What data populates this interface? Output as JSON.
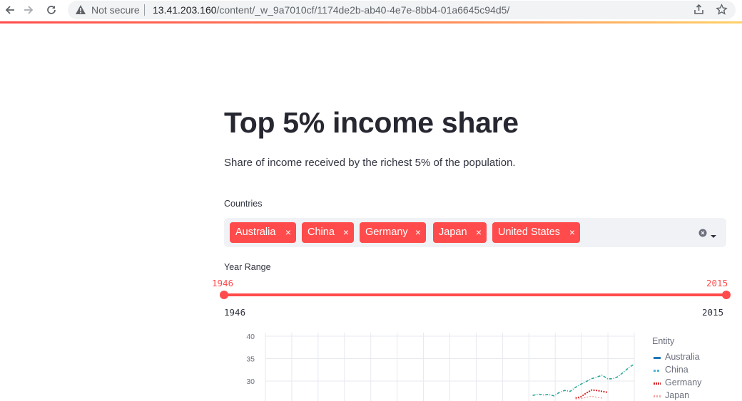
{
  "browser": {
    "security_label": "Not secure",
    "url_host": "13.41.203.160",
    "url_path": "/content/_w_9a7010cf/1174de2b-ab40-4e7e-8bb4-01a6645c94d5/"
  },
  "page": {
    "title": "Top 5% income share",
    "subtitle": "Share of income received by the richest 5% of the population.",
    "countries_label": "Countries",
    "selected_countries": [
      {
        "label": "Australia",
        "remove": "×"
      },
      {
        "label": "China",
        "remove": "×"
      },
      {
        "label": "Germany",
        "remove": "×"
      },
      {
        "label": "Japan",
        "remove": "×"
      },
      {
        "label": "United States",
        "remove": "×"
      }
    ],
    "year_range_label": "Year Range",
    "year_range": {
      "selected_min": "1946",
      "selected_max": "2015",
      "min": "1946",
      "max": "2015"
    }
  },
  "colors": {
    "accent": "#ff4b4b",
    "australia": "#1f77b4",
    "china": "#4fb5d9",
    "germany": "#d62728",
    "japan": "#f4a6a6",
    "usa_visible_line": "#2ca89a"
  },
  "chart_data": {
    "type": "line",
    "y_ticks": [
      "40",
      "35",
      "30"
    ],
    "legend_title": "Entity",
    "legend": [
      "Australia",
      "China",
      "Germany",
      "Japan"
    ],
    "series": [
      {
        "name": "China",
        "x": [
          1996,
          1997,
          1998,
          1999,
          2000,
          2001,
          2002,
          2003,
          2004,
          2005,
          2006,
          2007,
          2008,
          2009,
          2010,
          2011,
          2012,
          2013,
          2014,
          2015
        ],
        "values": [
          26.8,
          27.1,
          26.9,
          27.0,
          26.7,
          27.5,
          27.9,
          27.7,
          28.6,
          29.3,
          29.9,
          30.5,
          30.9,
          31.3,
          30.5,
          30.5,
          31.0,
          32.0,
          33.0,
          33.8
        ]
      },
      {
        "name": "Germany",
        "x": [
          2004,
          2005,
          2006,
          2007,
          2008,
          2009,
          2010
        ],
        "values": [
          26.2,
          26.5,
          27.3,
          28.0,
          27.9,
          27.7,
          27.5
        ]
      },
      {
        "name": "Japan",
        "x": [
          2004,
          2005,
          2006,
          2007,
          2008,
          2009
        ],
        "values": [
          26.0,
          26.1,
          26.4,
          26.6,
          26.4,
          26.2
        ]
      }
    ]
  }
}
